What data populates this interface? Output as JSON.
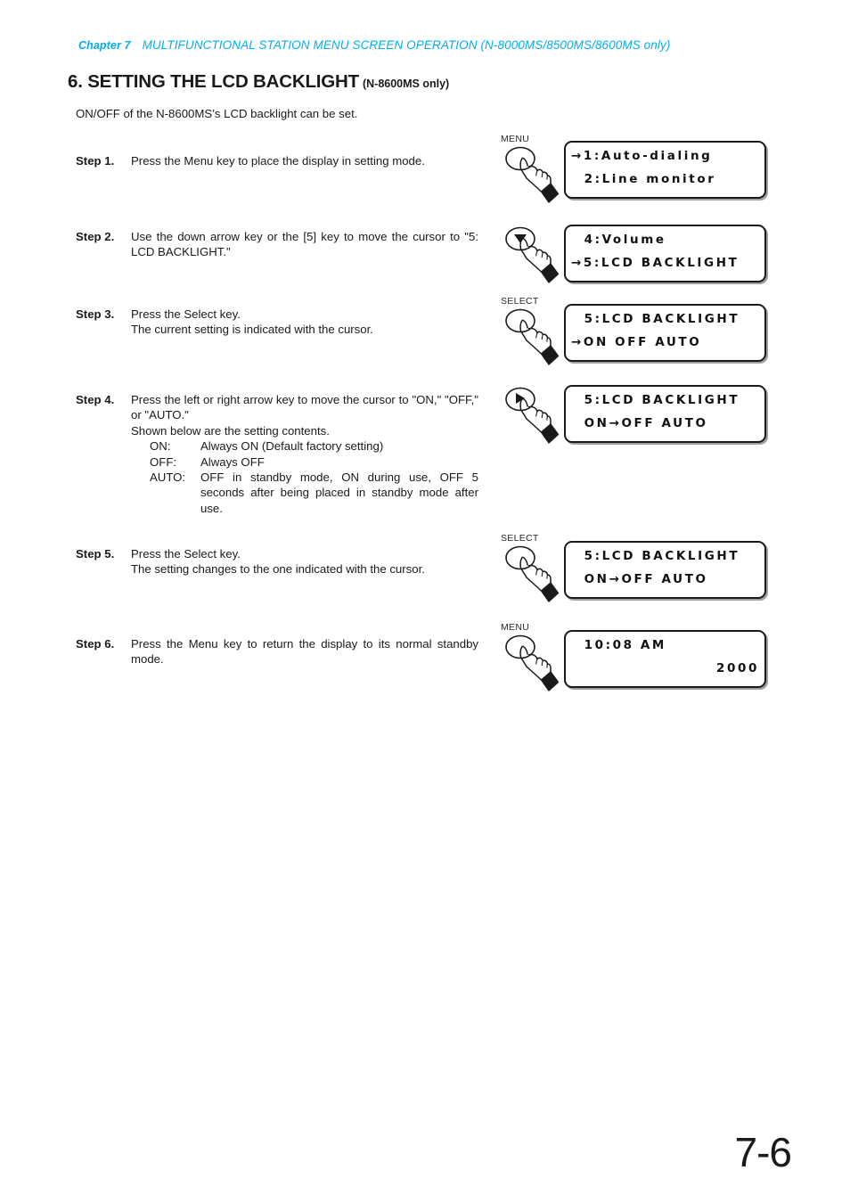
{
  "header": {
    "chapter": "Chapter 7",
    "title": "MULTIFUNCTIONAL STATION MENU SCREEN OPERATION (N-8000MS/8500MS/8600MS only)",
    "accent_color": "#00aeef"
  },
  "section": {
    "title": "6. SETTING THE LCD BACKLIGHT",
    "subtitle": "(N-8600MS only)"
  },
  "intro": "ON/OFF of the N-8600MS’s LCD backlight can be set.",
  "steps": [
    {
      "label": "Step 1.",
      "lines": [
        "Press the Menu key to place the display in setting mode."
      ]
    },
    {
      "label": "Step 2.",
      "lines": [
        "Use the down arrow key or the [5] key to move the cursor to \"5: LCD BACKLIGHT.\""
      ]
    },
    {
      "label": "Step 3.",
      "lines": [
        "Press the Select key.",
        "The current setting is indicated with the cursor."
      ]
    },
    {
      "label": "Step 4.",
      "lines": [
        "Press the left or right arrow key to move the cursor to \"ON,\" \"OFF,\" or \"AUTO.\"",
        "Shown below are the setting contents."
      ],
      "options": [
        {
          "key": "ON:",
          "value": "Always ON (Default factory setting)"
        },
        {
          "key": "OFF:",
          "value": "Always OFF"
        },
        {
          "key": "AUTO:",
          "value": "OFF in standby mode, ON during use, OFF 5 seconds after being placed in standby mode after use."
        }
      ]
    },
    {
      "label": "Step 5.",
      "lines": [
        "Press the Select key.",
        "The setting changes to the one indicated with the cursor."
      ]
    },
    {
      "label": "Step 6.",
      "lines": [
        "Press the Menu key to return the display to its normal standby mode."
      ]
    }
  ],
  "figures": [
    {
      "key_label": "MENU",
      "key_glyph": "none",
      "line1": "→1:Auto-dialing",
      "line2": "  2:Line monitor"
    },
    {
      "key_label": "",
      "key_glyph": "down-triangle",
      "line1": "  4:Volume",
      "line2": "→5:LCD BACKLIGHT"
    },
    {
      "key_label": "SELECT",
      "key_glyph": "none",
      "line1": "  5:LCD BACKLIGHT",
      "line2": "→ON OFF AUTO"
    },
    {
      "key_label": "",
      "key_glyph": "right-triangle",
      "line1": "  5:LCD BACKLIGHT",
      "line2": "  ON→OFF AUTO"
    },
    {
      "key_label": "SELECT",
      "key_glyph": "none",
      "line1": "  5:LCD BACKLIGHT",
      "line2": "  ON→OFF AUTO"
    },
    {
      "key_label": "MENU",
      "key_glyph": "none",
      "line1": "  10:08 AM",
      "line2": "2000"
    }
  ],
  "page_number": "7-6"
}
